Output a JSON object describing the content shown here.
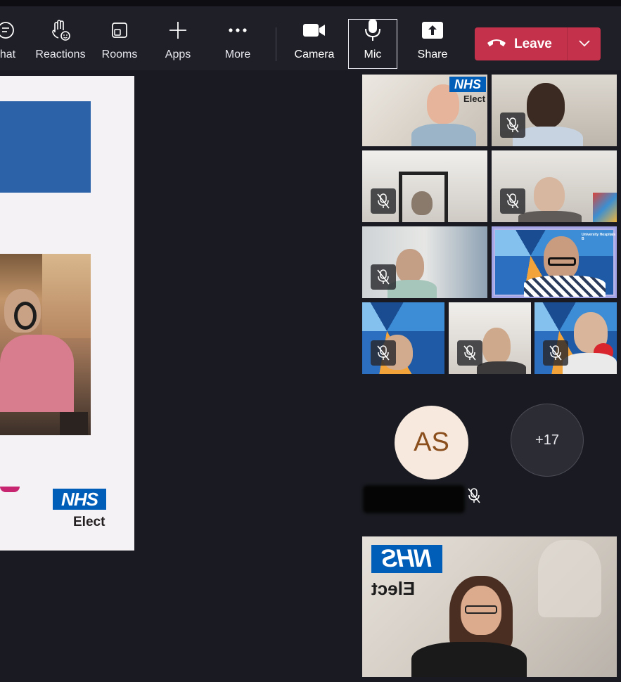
{
  "toolbar": {
    "chat_label": "hat",
    "reactions_label": "Reactions",
    "rooms_label": "Rooms",
    "apps_label": "Apps",
    "more_label": "More",
    "camera_label": "Camera",
    "mic_label": "Mic",
    "share_label": "Share",
    "leave_label": "Leave"
  },
  "presentation": {
    "nhs_logo": "NHS",
    "nhs_sub": "Elect"
  },
  "tiles": {
    "tile1_nhs": "NHS",
    "tile1_sub": "Elect",
    "speaker_banner": "University Hospitals B"
  },
  "participants": {
    "avatar_initials": "AS",
    "overflow_count": "+17"
  },
  "self_view": {
    "nhs_logo": "NHS",
    "nhs_sub": "Elect"
  },
  "colors": {
    "leave": "#c4314b",
    "nhs_blue": "#005eb8",
    "speaking_outline": "#a3a3e8"
  }
}
